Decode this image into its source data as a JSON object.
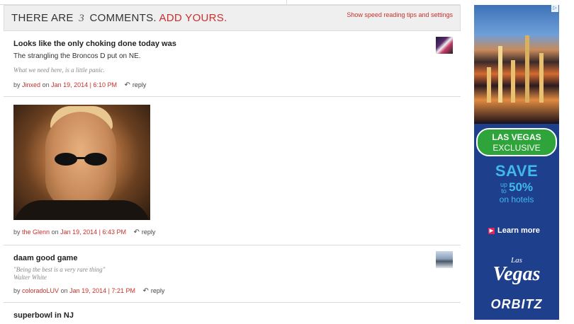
{
  "header": {
    "prefix": "THERE ARE",
    "count": "3",
    "suffix": "COMMENTS.",
    "add_link": "ADD YOURS.",
    "tips_link": "Show speed reading tips and settings"
  },
  "comments": [
    {
      "title": "Looks like the only choking done today was",
      "text": "The strangling the Broncos D put on NE.",
      "signature": "What we need here, is a little panic.",
      "by": "by",
      "author": "Jinxed",
      "on": "on",
      "date": "Jan 19, 2014 | 6:10 PM",
      "reply": "reply"
    },
    {
      "by": "by",
      "author": "the Glenn",
      "on": "on",
      "date": "Jan 19, 2014 | 6:43 PM",
      "reply": "reply"
    },
    {
      "title": "daam good game",
      "signature_line1": "\"Being the best is a very rare thing\"",
      "signature_line2": "Walter White",
      "by": "by",
      "author": "coloradoLUV",
      "on": "on",
      "date": "Jan 19, 2014 | 7:21 PM",
      "reply": "reply"
    },
    {
      "title": "superbowl in NJ"
    }
  ],
  "ad": {
    "badge_line1": "LAS VEGAS",
    "badge_line2": "EXCLUSIVE",
    "save": "SAVE",
    "up_to_1": "up",
    "up_to_2": "to",
    "percent": "50%",
    "on_hotels": "on hotels",
    "learn_more": "Learn more",
    "vegas_small": "Las",
    "vegas_script": "Vegas",
    "brand": "ORBITZ"
  }
}
